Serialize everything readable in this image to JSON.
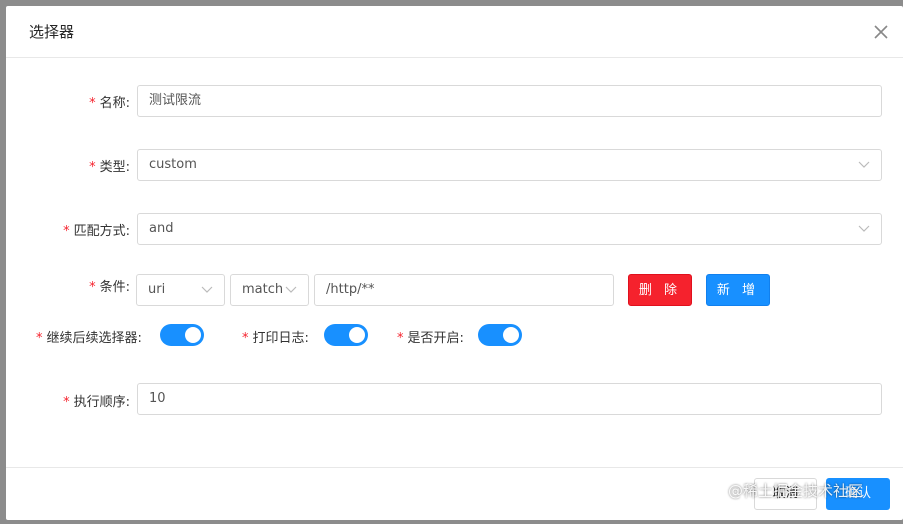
{
  "modal": {
    "title": "选择器",
    "close_icon": "close-icon"
  },
  "form": {
    "required_mark": "*",
    "name": {
      "label": "名称:",
      "value": "测试限流"
    },
    "type": {
      "label": "类型:",
      "value": "custom"
    },
    "match_mode": {
      "label": "匹配方式:",
      "value": "and"
    },
    "condition": {
      "label": "条件:",
      "param_type": "uri",
      "operator": "match",
      "value": "/http/**",
      "delete_label": "删 除",
      "add_label": "新 增"
    },
    "continued": {
      "label": "继续后续选择器:",
      "on": true
    },
    "logged": {
      "label": "打印日志:",
      "on": true
    },
    "enabled": {
      "label": "是否开启:",
      "on": true
    },
    "sort": {
      "label": "执行顺序:",
      "value": "10"
    }
  },
  "footer": {
    "cancel_label": "取消",
    "ok_label": "确认"
  },
  "watermark": "@稀土掘金技术社区",
  "colors": {
    "primary": "#1890ff",
    "danger": "#f5222d",
    "required": "#f5222d"
  }
}
